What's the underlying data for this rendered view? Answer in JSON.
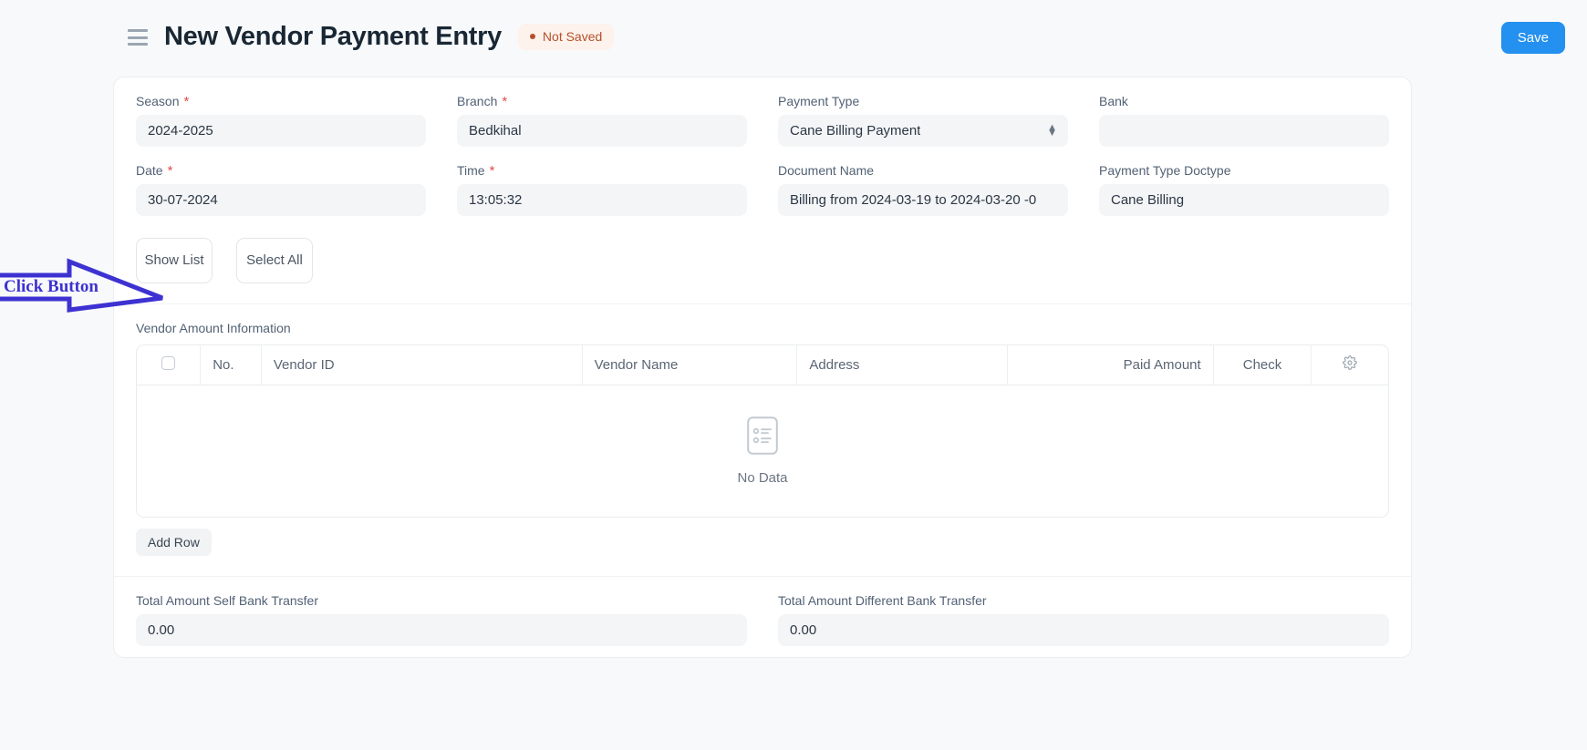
{
  "header": {
    "menu_icon": "hamburger-icon",
    "title": "New Vendor Payment Entry",
    "status": "Not Saved",
    "save_label": "Save"
  },
  "form": {
    "fields": [
      {
        "label": "Season",
        "required": true,
        "value": "2024-2025",
        "type": "text"
      },
      {
        "label": "Branch",
        "required": true,
        "value": "Bedkihal",
        "type": "text"
      },
      {
        "label": "Payment Type",
        "required": false,
        "value": "Cane Billing Payment",
        "type": "select"
      },
      {
        "label": "Bank",
        "required": false,
        "value": "",
        "type": "text"
      },
      {
        "label": "Date",
        "required": true,
        "value": "30-07-2024",
        "type": "text"
      },
      {
        "label": "Time",
        "required": true,
        "value": "13:05:32",
        "type": "text"
      },
      {
        "label": "Document Name",
        "required": false,
        "value": "Billing from 2024-03-19 to 2024-03-20 -0",
        "type": "text"
      },
      {
        "label": "Payment Type Doctype",
        "required": false,
        "value": "Cane Billing",
        "type": "text"
      }
    ]
  },
  "actions": {
    "show_list_label": "Show List",
    "select_all_label": "Select All"
  },
  "grid": {
    "section_label": "Vendor Amount Information",
    "columns": [
      {
        "label": "",
        "align": "center"
      },
      {
        "label": "No.",
        "align": "left"
      },
      {
        "label": "Vendor ID",
        "align": "left"
      },
      {
        "label": "Vendor Name",
        "align": "left"
      },
      {
        "label": "Address",
        "align": "left"
      },
      {
        "label": "Paid Amount",
        "align": "right"
      },
      {
        "label": "Check",
        "align": "center"
      },
      {
        "label": "",
        "align": "center"
      }
    ],
    "empty_text": "No Data",
    "empty_icon": "document-list-icon",
    "settings_icon": "gear-icon",
    "add_row_label": "Add Row",
    "rows": []
  },
  "totals": [
    {
      "label": "Total Amount Self Bank Transfer",
      "value": "0.00"
    },
    {
      "label": "Total Amount Different Bank Transfer",
      "value": "0.00"
    }
  ],
  "annotation": {
    "label": "Click Button",
    "arrow_icon": "right-arrow-annotation",
    "color": "#3d32d1"
  },
  "colors": {
    "accent": "#2490ef",
    "status_bg": "#fdf2ec",
    "status_fg": "#b5502a",
    "page_bg": "#f8f9fa",
    "field_bg": "#f4f5f6"
  }
}
